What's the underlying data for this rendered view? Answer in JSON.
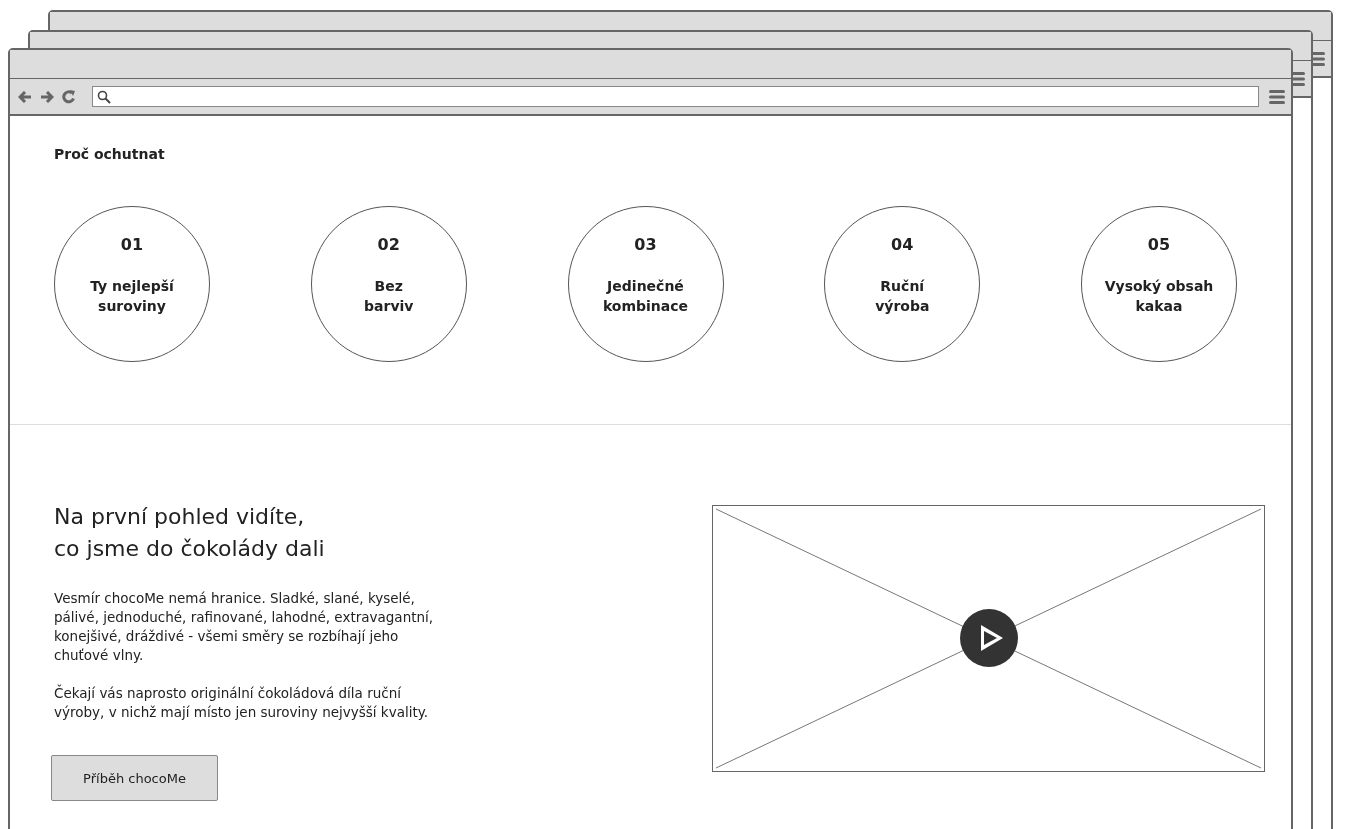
{
  "back_windows": [
    {
      "kind": "browser"
    },
    {
      "kind": "browser"
    }
  ],
  "section_title": "Proč ochutnat",
  "features": [
    {
      "number": "01",
      "label": "Ty nejlepší\nsuroviny"
    },
    {
      "number": "02",
      "label": "Bez\nbarviv"
    },
    {
      "number": "03",
      "label": "Jedinečné\nkombinace"
    },
    {
      "number": "04",
      "label": "Ruční\nvýroba"
    },
    {
      "number": "05",
      "label": "Vysoký obsah\nkakaa"
    }
  ],
  "intro": {
    "heading": "Na první pohled vidíte,\nco jsme do čokolády dali",
    "paragraphs": [
      "Vesmír chocoMe nemá hranice. Sladké, slané, kyselé, pálivé, jednoduché, rafinované, lahodné, extravagantní, konejšivé, dráždivé - všemi směry se rozbíhají jeho chuťové vlny.",
      "Čekají vás naprosto originální čokoládová díla ruční výroby, v nichž mají místo jen suroviny nejvyšší kvality."
    ],
    "button": "Příběh chocoMe"
  },
  "video": {
    "kind": "video"
  }
}
